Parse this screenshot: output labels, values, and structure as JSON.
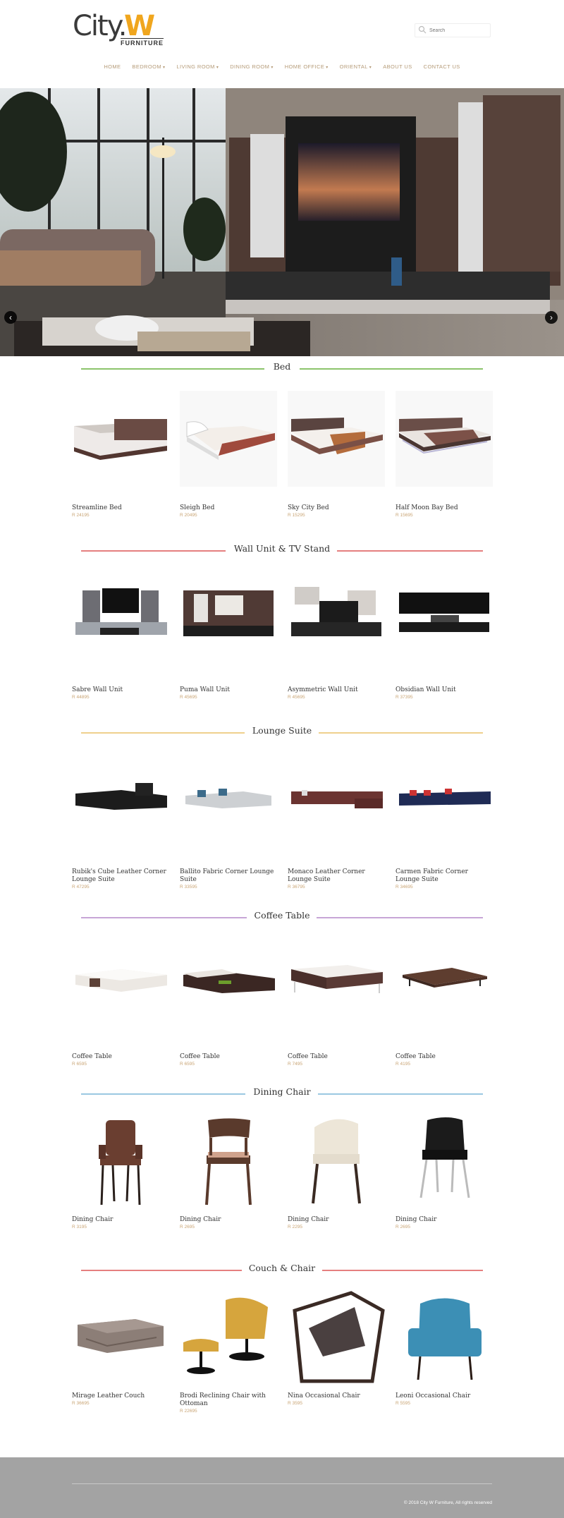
{
  "header": {
    "logo": {
      "city": "City.",
      "w": "W",
      "furniture": "FURNITURE"
    },
    "search_placeholder": "Search",
    "nav": [
      {
        "label": "HOME",
        "dropdown": false
      },
      {
        "label": "BEDROOM",
        "dropdown": true
      },
      {
        "label": "LIVING ROOM",
        "dropdown": true
      },
      {
        "label": "DINING ROOM",
        "dropdown": true
      },
      {
        "label": "HOME OFFICE",
        "dropdown": true
      },
      {
        "label": "ORIENTAL",
        "dropdown": true
      },
      {
        "label": "ABOUT US",
        "dropdown": false
      },
      {
        "label": "CONTACT US",
        "dropdown": false
      }
    ]
  },
  "hero": {
    "prev_icon": "chevron-left-icon",
    "next_icon": "chevron-right-icon"
  },
  "sections": [
    {
      "title": "Bed",
      "color": "#8cc46c",
      "products": [
        {
          "name": "Streamline Bed",
          "price": "R 24195"
        },
        {
          "name": "Sleigh Bed",
          "price": "R 20495"
        },
        {
          "name": "Sky City Bed",
          "price": "R 15295"
        },
        {
          "name": "Half Moon Bay Bed",
          "price": "R 15695"
        }
      ]
    },
    {
      "title": "Wall Unit & TV Stand",
      "color": "#e57f7f",
      "products": [
        {
          "name": "Sabre Wall Unit",
          "price": "R 44895"
        },
        {
          "name": "Puma Wall Unit",
          "price": "R 45695"
        },
        {
          "name": "Asymmetric Wall Unit",
          "price": "R 45695"
        },
        {
          "name": "Obsidian Wall Unit",
          "price": "R 37395"
        }
      ]
    },
    {
      "title": "Lounge Suite",
      "color": "#efd08d",
      "products": [
        {
          "name": "Rubik's Cube Leather Corner Lounge Suite",
          "price": "R 47295"
        },
        {
          "name": "Ballito Fabric Corner Lounge Suite",
          "price": "R 33595"
        },
        {
          "name": "Monaco Leather Corner Lounge Suite",
          "price": "R 36795"
        },
        {
          "name": "Carmen Fabric Corner Lounge Suite",
          "price": "R 34695"
        }
      ]
    },
    {
      "title": "Coffee Table",
      "color": "#c7a6d6",
      "products": [
        {
          "name": "Coffee Table",
          "price": "R 6595"
        },
        {
          "name": "Coffee Table",
          "price": "R 6595"
        },
        {
          "name": "Coffee Table",
          "price": "R 7495"
        },
        {
          "name": "Coffee Table",
          "price": "R 4195"
        }
      ]
    },
    {
      "title": "Dining Chair",
      "color": "#9bc8e2",
      "products": [
        {
          "name": "Dining Chair",
          "price": "R 3195"
        },
        {
          "name": "Dining Chair",
          "price": "R 2695"
        },
        {
          "name": "Dining Chair",
          "price": "R 2295"
        },
        {
          "name": "Dining Chair",
          "price": "R 2695"
        }
      ]
    },
    {
      "title": "Couch & Chair",
      "color": "#e57f7f",
      "products": [
        {
          "name": "Mirage Leather Couch",
          "price": "R 36695"
        },
        {
          "name": "Brodi Reclining Chair with Ottoman",
          "price": "R 22695"
        },
        {
          "name": "Nina Occasional Chair",
          "price": "R 3595"
        },
        {
          "name": "Leoni Occasional Chair",
          "price": "R 5595"
        }
      ]
    }
  ],
  "footer": {
    "copyright": "© 2018 City W Furniture, All rights reserved"
  }
}
